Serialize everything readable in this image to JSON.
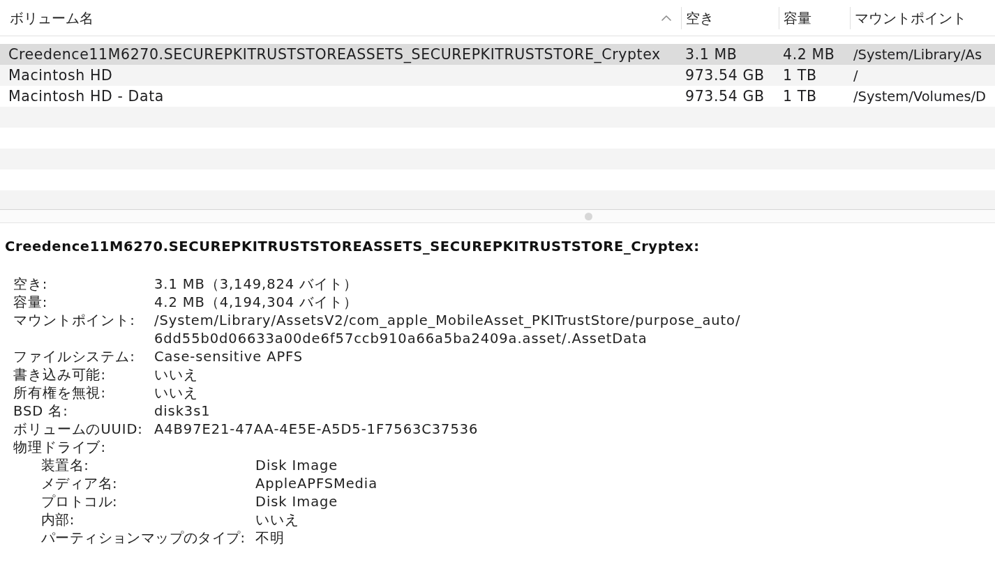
{
  "table": {
    "columns": [
      {
        "label": "ボリューム名",
        "sorted": true
      },
      {
        "label": "空き",
        "sorted": false
      },
      {
        "label": "容量",
        "sorted": false
      },
      {
        "label": "マウントポイント",
        "sorted": false
      }
    ],
    "rows": [
      {
        "selected": true,
        "cells": [
          "Creedence11M6270.SECUREPKITRUSTSTOREASSETS_SECUREPKITRUSTSTORE_Cryptex",
          "3.1 MB",
          "4.2 MB",
          "/System/Library/As"
        ]
      },
      {
        "selected": false,
        "cells": [
          "Macintosh HD",
          "973.54 GB",
          "1 TB",
          "/"
        ]
      },
      {
        "selected": false,
        "cells": [
          "Macintosh HD - Data",
          "973.54 GB",
          "1 TB",
          "/System/Volumes/D"
        ]
      }
    ]
  },
  "details": {
    "title": "Creedence11M6270.SECUREPKITRUSTSTOREASSETS_SECUREPKITRUSTSTORE_Cryptex:",
    "fields": [
      {
        "label": "空き:",
        "value": "3.1 MB（3,149,824 バイト）"
      },
      {
        "label": "容量:",
        "value": "4.2 MB（4,194,304 バイト）"
      },
      {
        "label": "マウントポイント:",
        "value": "/System/Library/AssetsV2/com_apple_MobileAsset_PKITrustStore/purpose_auto/6dd55b0d06633a00de6f57ccb910a66a5ba2409a.asset/.AssetData"
      },
      {
        "label": "ファイルシステム:",
        "value": "Case-sensitive APFS"
      },
      {
        "label": "書き込み可能:",
        "value": "いいえ"
      },
      {
        "label": "所有権を無視:",
        "value": "いいえ"
      },
      {
        "label": "BSD 名:",
        "value": "disk3s1"
      },
      {
        "label": "ボリュームのUUID:",
        "value": "A4B97E21-47AA-4E5E-A5D5-1F7563C37536"
      },
      {
        "label": "物理ドライブ:",
        "children": [
          {
            "label": "装置名:",
            "value": "Disk Image"
          },
          {
            "label": "メディア名:",
            "value": "AppleAPFSMedia"
          },
          {
            "label": "プロトコル:",
            "value": "Disk Image"
          },
          {
            "label": "内部:",
            "value": "いいえ"
          },
          {
            "label": "パーティションマップのタイプ:",
            "value": "不明"
          }
        ]
      }
    ]
  }
}
